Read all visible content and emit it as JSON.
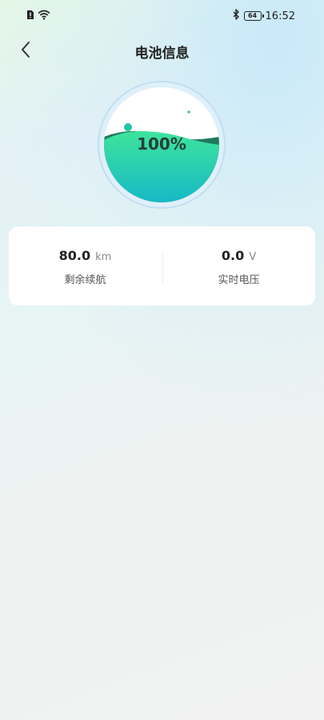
{
  "status_bar": {
    "time": "16:52",
    "battery_level": "64",
    "icons": [
      "sim-alert-icon",
      "wifi-icon",
      "bluetooth-icon",
      "battery-icon"
    ]
  },
  "header": {
    "title": "电池信息",
    "back_icon": "chevron-left-icon"
  },
  "battery_gauge": {
    "percent_text": "100%",
    "fill_level": 1.0
  },
  "stats": {
    "range": {
      "value": "80.0",
      "unit": "km",
      "label": "剩余续航"
    },
    "voltage": {
      "value": "0.0",
      "unit": "V",
      "label": "实时电压"
    }
  },
  "colors": {
    "wave_front_top": "#3ee49c",
    "wave_front_bottom": "#17b9c6",
    "wave_back": "#1f7a5e",
    "accent_dot": "#1fc6a5"
  }
}
